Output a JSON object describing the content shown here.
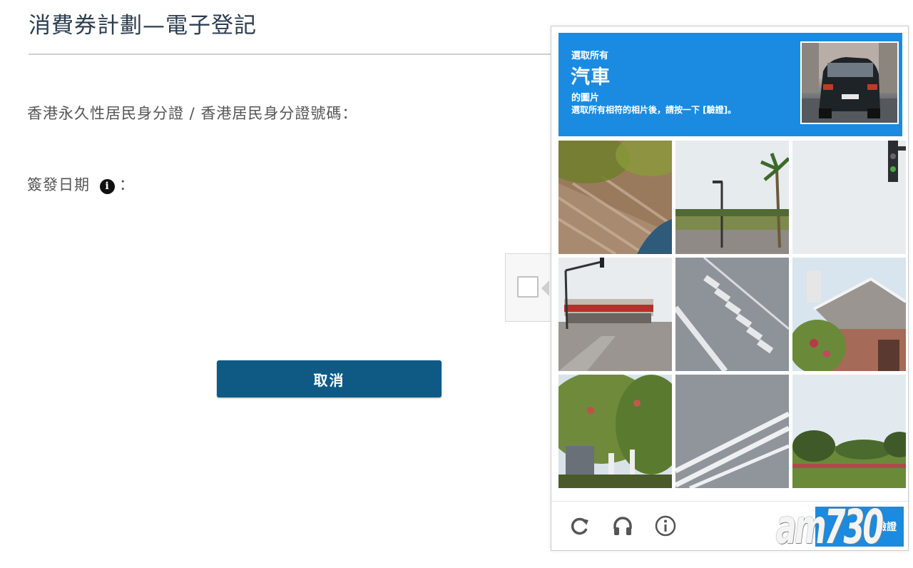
{
  "page": {
    "title": "消費券計劃—電子登記",
    "id_label": "香港永久性居民身分證 / 香港居民身分證號碼：",
    "issue_date_label": "簽發日期",
    "issue_date_suffix": "：",
    "info_glyph": "i",
    "cancel_label": "取消"
  },
  "captcha": {
    "header": {
      "select_all": "選取所有",
      "target": "汽車",
      "images_of": "的圖片",
      "instruction": "選取所有相符的相片後，請按一下 [驗證]。"
    },
    "tiles": [
      {
        "name": "tile-roof-foliage"
      },
      {
        "name": "tile-palm-street"
      },
      {
        "name": "tile-traffic-light-edge"
      },
      {
        "name": "tile-gas-station"
      },
      {
        "name": "tile-crosswalk"
      },
      {
        "name": "tile-house"
      },
      {
        "name": "tile-trees"
      },
      {
        "name": "tile-road-lines"
      },
      {
        "name": "tile-field-trees"
      }
    ],
    "footer": {
      "reload_icon": "reload-icon",
      "audio_icon": "headphones-icon",
      "info_icon": "info-icon",
      "verify_label": "驗證"
    },
    "colors": {
      "header": "#1a8be0",
      "cancel_button": "#0e5a85"
    }
  },
  "watermark": {
    "text": "am730"
  }
}
